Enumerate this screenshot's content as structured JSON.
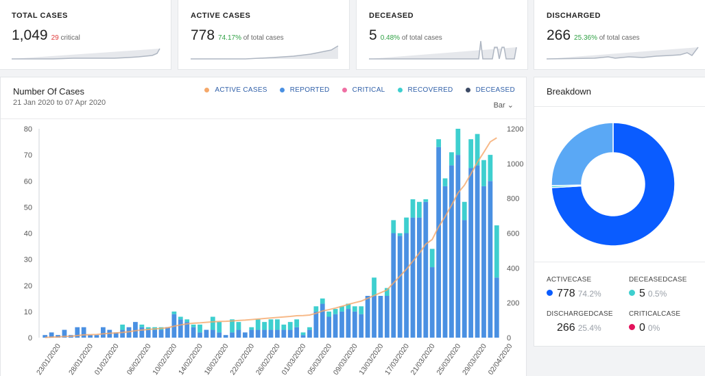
{
  "stats": [
    {
      "label": "TOTAL CASES",
      "value": "1,049",
      "sub_value": "29",
      "sub_text": "critical",
      "sub_color": "#e03b3b"
    },
    {
      "label": "ACTIVE CASES",
      "value": "778",
      "pct": "74.17%",
      "sub_text": "of total cases",
      "sub_color": "#2ea043"
    },
    {
      "label": "DECEASED",
      "value": "5",
      "pct": "0.48%",
      "sub_text": "of total cases",
      "sub_color": "#2ea043"
    },
    {
      "label": "DISCHARGED",
      "value": "266",
      "pct": "25.36%",
      "sub_text": "of total cases",
      "sub_color": "#2ea043"
    }
  ],
  "chart": {
    "title": "Number Of Cases",
    "date_range": "21 Jan 2020 to 07 Apr 2020",
    "type_selector": "Bar",
    "legend": [
      {
        "label": "ACTIVE CASES",
        "color": "#f5a86a"
      },
      {
        "label": "REPORTED",
        "color": "#4a90e2"
      },
      {
        "label": "CRITICAL",
        "color": "#ef6fa3"
      },
      {
        "label": "RECOVERED",
        "color": "#3ecfcf"
      },
      {
        "label": "DECEASED",
        "color": "#3d4b66"
      }
    ]
  },
  "chart_data": {
    "type": "bar",
    "x": [
      "21/01/2020",
      "22/01/2020",
      "23/01/2020",
      "24/01/2020",
      "25/01/2020",
      "26/01/2020",
      "27/01/2020",
      "28/01/2020",
      "29/01/2020",
      "30/01/2020",
      "31/01/2020",
      "01/02/2020",
      "02/02/2020",
      "03/02/2020",
      "04/02/2020",
      "05/02/2020",
      "06/02/2020",
      "07/02/2020",
      "08/02/2020",
      "09/02/2020",
      "10/02/2020",
      "11/02/2020",
      "12/02/2020",
      "13/02/2020",
      "14/02/2020",
      "15/02/2020",
      "16/02/2020",
      "17/02/2020",
      "18/02/2020",
      "19/02/2020",
      "20/02/2020",
      "21/02/2020",
      "22/02/2020",
      "23/02/2020",
      "24/02/2020",
      "25/02/2020",
      "26/02/2020",
      "27/02/2020",
      "28/02/2020",
      "29/02/2020",
      "01/03/2020",
      "02/03/2020",
      "03/03/2020",
      "04/03/2020",
      "05/03/2020",
      "06/03/2020",
      "07/03/2020",
      "08/03/2020",
      "09/03/2020",
      "10/03/2020",
      "11/03/2020",
      "12/03/2020",
      "13/03/2020",
      "14/03/2020",
      "15/03/2020",
      "16/03/2020",
      "17/03/2020",
      "18/03/2020",
      "19/03/2020",
      "20/03/2020",
      "21/03/2020",
      "22/03/2020",
      "23/03/2020",
      "24/03/2020",
      "25/03/2020",
      "26/03/2020",
      "27/03/2020",
      "28/03/2020",
      "29/03/2020",
      "30/03/2020",
      "31/03/2020",
      "01/04/2020",
      "02/04/2020",
      "03/04/2020"
    ],
    "x_tick_labels": [
      "23/01/2020",
      "28/01/2020",
      "01/02/2020",
      "06/02/2020",
      "10/02/2020",
      "14/02/2020",
      "18/02/2020",
      "22/02/2020",
      "26/02/2020",
      "01/03/2020",
      "05/03/2020",
      "09/03/2020",
      "13/03/2020",
      "17/03/2020",
      "21/03/2020",
      "25/03/2020",
      "29/03/2020",
      "02/04/2020"
    ],
    "series": [
      {
        "name": "REPORTED",
        "color": "#4a90e2",
        "values": [
          1,
          2,
          1,
          3,
          1,
          4,
          4,
          1,
          1,
          4,
          3,
          2,
          3,
          4,
          6,
          4,
          3,
          3,
          3,
          4,
          9,
          7,
          6,
          4,
          2,
          3,
          3,
          2,
          1,
          2,
          3,
          2,
          3,
          3,
          3,
          3,
          3,
          3,
          3,
          4,
          1,
          3,
          10,
          13,
          8,
          9,
          10,
          11,
          10,
          9,
          16,
          16,
          16,
          16,
          40,
          39,
          40,
          46,
          46,
          52,
          27,
          73,
          58,
          66,
          70,
          45,
          65,
          66,
          58,
          60,
          23
        ],
        "note_len": 71
      },
      {
        "name": "RECOVERED",
        "color": "#3ecfcf",
        "values": [
          0,
          0,
          0,
          0,
          0,
          0,
          0,
          0,
          0,
          0,
          0,
          0,
          2,
          0,
          0,
          1,
          1,
          1,
          1,
          0,
          1,
          1,
          1,
          1,
          3,
          0,
          5,
          4,
          0,
          5,
          3,
          0,
          1,
          4,
          3,
          4,
          4,
          2,
          3,
          3,
          1,
          1,
          2,
          2,
          2,
          2,
          2,
          2,
          2,
          3,
          0,
          7,
          0,
          3,
          5,
          1,
          6,
          7,
          6,
          1,
          7,
          3,
          3,
          5,
          10,
          7,
          11,
          12,
          10,
          10,
          20
        ],
        "note_len": 71
      },
      {
        "name": "ACTIVE CASES",
        "color": "#f5a86a",
        "values": [
          1,
          3,
          4,
          7,
          8,
          12,
          16,
          17,
          18,
          22,
          25,
          27,
          30,
          34,
          40,
          44,
          47,
          50,
          53,
          57,
          66,
          73,
          79,
          83,
          85,
          88,
          91,
          93,
          94,
          96,
          99,
          101,
          104,
          107,
          110,
          113,
          116,
          119,
          122,
          126,
          127,
          130,
          140,
          153,
          161,
          170,
          180,
          191,
          201,
          210,
          226,
          242,
          258,
          274,
          314,
          353,
          393,
          439,
          485,
          537,
          564,
          637,
          695,
          761,
          831,
          876,
          941,
          1007,
          1065,
          1125,
          1148
        ]
      }
    ],
    "y_left": {
      "min": 0,
      "max": 80,
      "ticks": [
        0,
        10,
        20,
        30,
        40,
        50,
        60,
        70,
        80
      ]
    },
    "y_right": {
      "min": 0,
      "max": 1200,
      "ticks": [
        0,
        200,
        400,
        600,
        800,
        1000,
        1200
      ]
    }
  },
  "breakdown": {
    "title": "Breakdown",
    "items": [
      {
        "label": "ACTIVECASE",
        "value": "778",
        "pct": "74.2%",
        "color": "#0a5cff"
      },
      {
        "label": "DECEASEDCASE",
        "value": "5",
        "pct": "0.5%",
        "color": "#3ecfcf"
      },
      {
        "label": "DISCHARGEDCASE",
        "value": "266",
        "pct": "25.4%",
        "color": "#ffffff"
      },
      {
        "label": "CRITICALCASE",
        "value": "0",
        "pct": "0%",
        "color": "#e3125b"
      }
    ],
    "donut": [
      {
        "name": "ACTIVECASE",
        "value": 74.2,
        "color": "#0a5cff"
      },
      {
        "name": "DECEASEDCASE",
        "value": 0.5,
        "color": "#3ecfcf"
      },
      {
        "name": "DISCHARGEDCASE",
        "value": 25.4,
        "color": "#5aa8f5"
      },
      {
        "name": "CRITICALCASE",
        "value": 0,
        "color": "#e3125b"
      }
    ]
  }
}
